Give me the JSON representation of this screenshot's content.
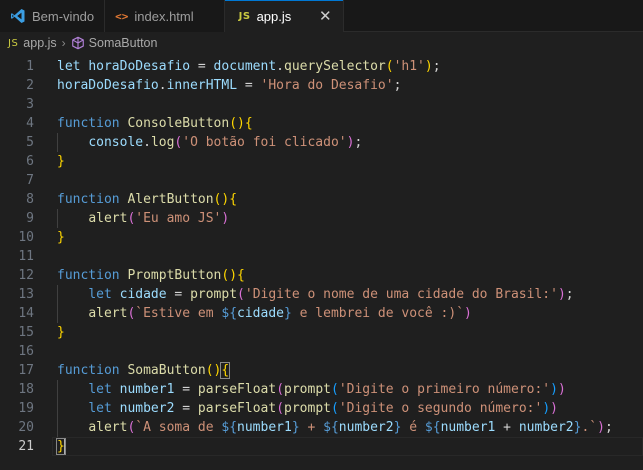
{
  "tabs": [
    {
      "label": "Bem-vindo",
      "icon": "vscode-icon",
      "active": false
    },
    {
      "label": "index.html",
      "icon": "html-icon",
      "icon_text": "<>",
      "active": false
    },
    {
      "label": "app.js",
      "icon": "js-icon",
      "icon_text": "JS",
      "active": true,
      "close": "✕"
    }
  ],
  "breadcrumb": {
    "file_icon_text": "JS",
    "file": "app.js",
    "separator": "›",
    "symbol": "SomaButton"
  },
  "editor": {
    "current_line": 21,
    "line_numbers": [
      "1",
      "2",
      "3",
      "4",
      "5",
      "6",
      "7",
      "8",
      "9",
      "10",
      "11",
      "12",
      "13",
      "14",
      "15",
      "16",
      "17",
      "18",
      "19",
      "20",
      "21"
    ],
    "lines": [
      [
        [
          "var",
          "let "
        ],
        [
          "var",
          "horaDoDesafio"
        ],
        [
          "p",
          " = "
        ],
        [
          "var",
          "document"
        ],
        [
          "p",
          "."
        ],
        [
          "fn",
          "querySelector"
        ],
        [
          "br1",
          "("
        ],
        [
          "str",
          "'h1'"
        ],
        [
          "br1",
          ")"
        ],
        [
          "p",
          ";"
        ]
      ],
      [
        [
          "var",
          "horaDoDesafio"
        ],
        [
          "p",
          "."
        ],
        [
          "var",
          "innerHTML"
        ],
        [
          "p",
          " = "
        ],
        [
          "str",
          "'Hora do Desafio'"
        ],
        [
          "p",
          ";"
        ]
      ],
      [],
      [
        [
          "kw",
          "function "
        ],
        [
          "fn",
          "ConsoleButton"
        ],
        [
          "br1",
          "()"
        ],
        [
          "br1",
          "{"
        ]
      ],
      [
        [
          "p",
          "    "
        ],
        [
          "var",
          "console"
        ],
        [
          "p",
          "."
        ],
        [
          "fn",
          "log"
        ],
        [
          "br2",
          "("
        ],
        [
          "str",
          "'O botão foi clicado'"
        ],
        [
          "br2",
          ")"
        ],
        [
          "p",
          ";"
        ]
      ],
      [
        [
          "br1",
          "}"
        ]
      ],
      [],
      [
        [
          "kw",
          "function "
        ],
        [
          "fn",
          "AlertButton"
        ],
        [
          "br1",
          "()"
        ],
        [
          "br1",
          "{"
        ]
      ],
      [
        [
          "p",
          "    "
        ],
        [
          "fn",
          "alert"
        ],
        [
          "br2",
          "("
        ],
        [
          "str",
          "'Eu amo JS'"
        ],
        [
          "br2",
          ")"
        ]
      ],
      [
        [
          "br1",
          "}"
        ]
      ],
      [],
      [
        [
          "kw",
          "function "
        ],
        [
          "fn",
          "PromptButton"
        ],
        [
          "br1",
          "()"
        ],
        [
          "br1",
          "{"
        ]
      ],
      [
        [
          "p",
          "    "
        ],
        [
          "kw",
          "let "
        ],
        [
          "var",
          "cidade"
        ],
        [
          "p",
          " = "
        ],
        [
          "fn",
          "prompt"
        ],
        [
          "br2",
          "("
        ],
        [
          "str",
          "'Digite o nome de uma cidade do Brasil:'"
        ],
        [
          "br2",
          ")"
        ],
        [
          "p",
          ";"
        ]
      ],
      [
        [
          "p",
          "    "
        ],
        [
          "fn",
          "alert"
        ],
        [
          "br2",
          "("
        ],
        [
          "str",
          "`Estive em "
        ],
        [
          "tp",
          "${"
        ],
        [
          "var",
          "cidade"
        ],
        [
          "tp",
          "}"
        ],
        [
          "str",
          " e lembrei de você :)`"
        ],
        [
          "br2",
          ")"
        ]
      ],
      [
        [
          "br1",
          "}"
        ]
      ],
      [],
      [
        [
          "kw",
          "function "
        ],
        [
          "fn",
          "SomaButton"
        ],
        [
          "br1",
          "()"
        ],
        [
          "br1 bm",
          "{"
        ]
      ],
      [
        [
          "p",
          "    "
        ],
        [
          "kw",
          "let "
        ],
        [
          "var",
          "number1"
        ],
        [
          "p",
          " = "
        ],
        [
          "fn",
          "parseFloat"
        ],
        [
          "br2",
          "("
        ],
        [
          "fn",
          "prompt"
        ],
        [
          "br3",
          "("
        ],
        [
          "str",
          "'Digite o primeiro número:'"
        ],
        [
          "br3",
          ")"
        ],
        [
          "br2",
          ")"
        ]
      ],
      [
        [
          "p",
          "    "
        ],
        [
          "kw",
          "let "
        ],
        [
          "var",
          "number2"
        ],
        [
          "p",
          " = "
        ],
        [
          "fn",
          "parseFloat"
        ],
        [
          "br2",
          "("
        ],
        [
          "fn",
          "prompt"
        ],
        [
          "br3",
          "("
        ],
        [
          "str",
          "'Digite o segundo número:'"
        ],
        [
          "br3",
          ")"
        ],
        [
          "br2",
          ")"
        ]
      ],
      [
        [
          "p",
          "    "
        ],
        [
          "fn",
          "alert"
        ],
        [
          "br2",
          "("
        ],
        [
          "str",
          "`A soma de "
        ],
        [
          "tp",
          "${"
        ],
        [
          "var",
          "number1"
        ],
        [
          "tp",
          "}"
        ],
        [
          "str",
          " + "
        ],
        [
          "tp",
          "${"
        ],
        [
          "var",
          "number2"
        ],
        [
          "tp",
          "}"
        ],
        [
          "str",
          " é "
        ],
        [
          "tp",
          "${"
        ],
        [
          "var",
          "number1"
        ],
        [
          "p",
          " + "
        ],
        [
          "var",
          "number2"
        ],
        [
          "tp",
          "}"
        ],
        [
          "str",
          ".`"
        ],
        [
          "br2",
          ")"
        ],
        [
          "p",
          ";"
        ]
      ],
      [
        [
          "br1 bm",
          "}"
        ],
        [
          "cursor",
          ""
        ]
      ]
    ]
  }
}
